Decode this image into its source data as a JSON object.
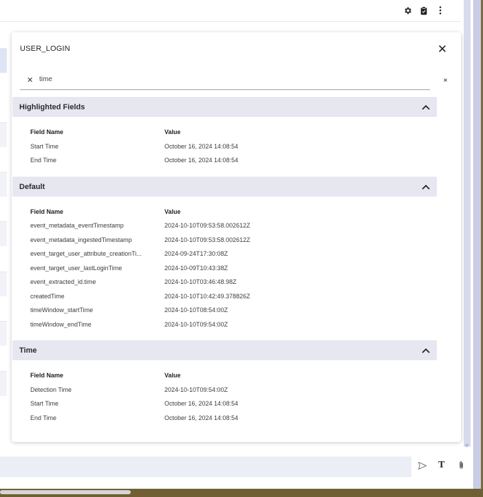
{
  "panel": {
    "title": "USER_LOGIN",
    "search": {
      "value": "time",
      "placeholder": ""
    }
  },
  "columns": {
    "field": "Field Name",
    "value": "Value"
  },
  "sections": [
    {
      "title": "Highlighted Fields",
      "rows": [
        {
          "field": "Start Time",
          "value": "October 16, 2024 14:08:54"
        },
        {
          "field": "End Time",
          "value": "October 16, 2024 14:08:54"
        }
      ]
    },
    {
      "title": "Default",
      "rows": [
        {
          "field": "event_metadata_eventTimestamp",
          "value": "2024-10-10T09:53:58.002612Z"
        },
        {
          "field": "event_metadata_ingestedTimestamp",
          "value": "2024-10-10T09:53:58.002612Z"
        },
        {
          "field": "event_target_user_attribute_creationTi...",
          "value": "2024-09-24T17:30:08Z"
        },
        {
          "field": "event_target_user_lastLoginTime",
          "value": "2024-10-09T10:43:38Z"
        },
        {
          "field": "event_extracted_id.time",
          "value": "2024-10-10T03:46:48.98Z"
        },
        {
          "field": "createdTime",
          "value": "2024-10-10T10:42:49.378826Z"
        },
        {
          "field": "timeWindow_startTime",
          "value": "2024-10-10T08:54:00Z"
        },
        {
          "field": "timeWindow_endTime",
          "value": "2024-10-10T09:54:00Z"
        }
      ]
    },
    {
      "title": "Time",
      "rows": [
        {
          "field": "Detection Time",
          "value": "2024-10-10T09:54:00Z"
        },
        {
          "field": "Start Time",
          "value": "October 16, 2024 14:08:54"
        },
        {
          "field": "End Time",
          "value": "October 16, 2024 14:08:54"
        }
      ]
    }
  ],
  "icons": {
    "settings": "gear-icon",
    "clipboard": "clipboard-icon",
    "more": "more-vert-icon",
    "close": "close-icon",
    "clear": "clear-icon",
    "collapse_all": "unfold-less-icon",
    "section_toggle": "chevron-up-icon",
    "send": "send-icon",
    "text_format": "text-format-icon",
    "attach": "paperclip-icon"
  },
  "colors": {
    "section_header_bg": "#e6e7f1",
    "scrollbar": "#c9cde6",
    "indicator": "#e02020"
  }
}
